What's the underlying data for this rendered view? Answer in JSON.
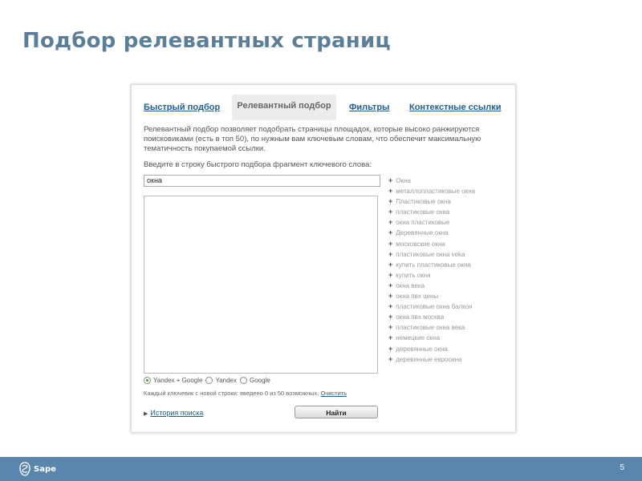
{
  "slide": {
    "title": "Подбор релевантных страниц",
    "page_number": "5",
    "logo_text": "Sape"
  },
  "tabs": [
    {
      "label": "Быстрый подбор",
      "active": false
    },
    {
      "label": "Релевантный подбор",
      "active": true
    },
    {
      "label": "Фильтры",
      "active": false
    },
    {
      "label": "Контекстные ссылки",
      "active": false
    }
  ],
  "content": {
    "description": "Релевантный подбор позволяет подобрать страницы площадок, которые высоко ранжируются поисковиками (есть в топ 50), по нужным вам ключевым словам, что обеспечит максимальную тематичность покупаемой ссылки.",
    "prompt": "Введите в строку быстрого подбора фрагмент ключевого слова:",
    "query_value": "окна",
    "keywords_value": "",
    "suggestions": [
      "Окна",
      "металлопластиковые окна",
      "Пластиковые окна",
      "пластиковые окна",
      "окна пластиковые",
      "Деревянные окна",
      "московские окна",
      "пластиковые окна veka",
      "купить пластиковые окна",
      "купить окна",
      "окна века",
      "окна пвх цены",
      "пластиковые окна балкон",
      "окна пвх москва",
      "пластиковые окна века",
      "немецкие окна",
      "деревянные окна",
      "деревянные евроокна"
    ],
    "engines": [
      {
        "label": "Yandex + Google",
        "checked": true
      },
      {
        "label": "Yandex",
        "checked": false
      },
      {
        "label": "Google",
        "checked": false
      }
    ],
    "counter_text": "Каждый ключевик с новой строки: введено 0 из 50 возможных.",
    "clear_label": "Очистить",
    "history_label": "История поиска",
    "find_label": "Найти"
  },
  "colors": {
    "title": "#5b7f99",
    "link": "#1d5f95",
    "footer": "#5a86ad",
    "active_tab": "#ececec"
  }
}
